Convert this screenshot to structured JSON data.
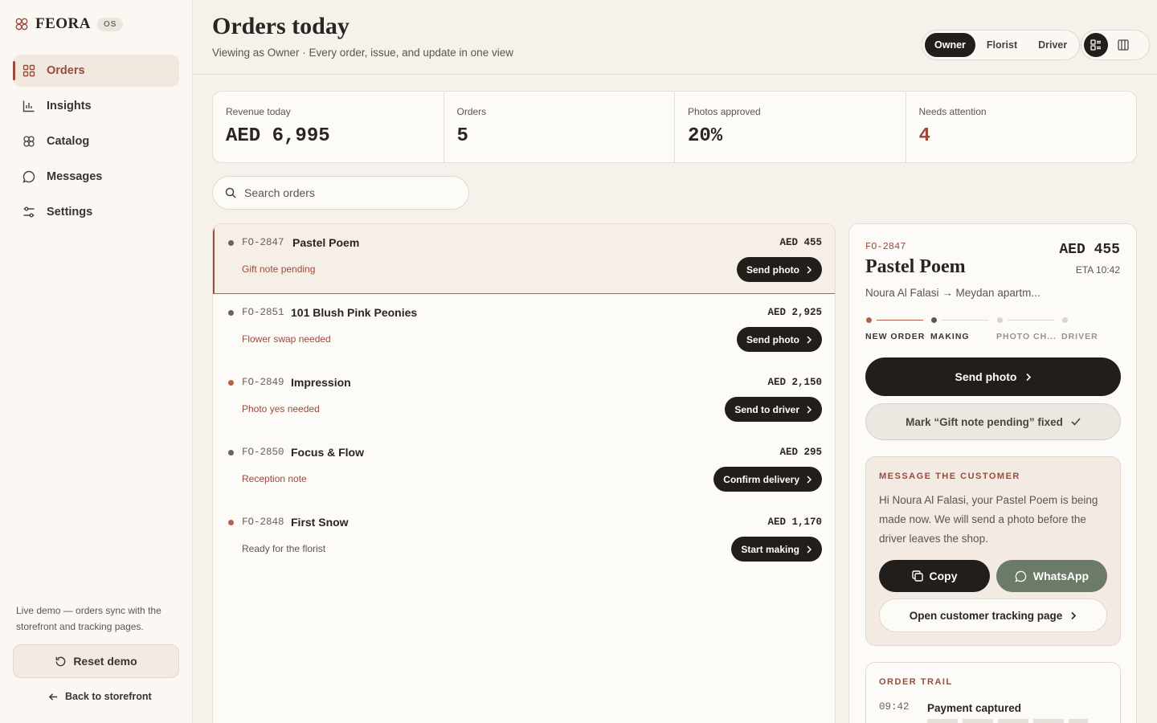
{
  "brand": {
    "name": "FEORA",
    "badge": "OS"
  },
  "sidebar": {
    "items": [
      {
        "label": "Orders",
        "icon": "grid-icon",
        "active": true
      },
      {
        "label": "Insights",
        "icon": "bar-chart-icon",
        "active": false
      },
      {
        "label": "Catalog",
        "icon": "flower-icon",
        "active": false
      },
      {
        "label": "Messages",
        "icon": "chat-bubble-icon",
        "active": false
      },
      {
        "label": "Settings",
        "icon": "sliders-icon",
        "active": false
      }
    ],
    "note": "Live demo — orders sync with the storefront and tracking pages.",
    "reset_label": "Reset demo",
    "back_label": "Back to storefront"
  },
  "header": {
    "title": "Orders today",
    "subtitle": "Viewing as Owner · Every order, issue, and update in one view",
    "roles": [
      "Owner",
      "Florist",
      "Driver"
    ],
    "active_role": "Owner",
    "views": [
      "list-view-icon",
      "board-view-icon"
    ],
    "active_view": "list-view-icon"
  },
  "stats": [
    {
      "label": "Revenue today",
      "value": "AED 6,995"
    },
    {
      "label": "Orders",
      "value": "5"
    },
    {
      "label": "Photos approved",
      "value": "20%"
    },
    {
      "label": "Needs attention",
      "value": "4"
    }
  ],
  "search": {
    "placeholder": "Search orders",
    "value": ""
  },
  "orders": [
    {
      "id": "FO-2847",
      "name": "Pastel Poem",
      "note": "Gift note pending",
      "price": "AED 455",
      "action": "Send photo",
      "selected": true
    },
    {
      "id": "FO-2851",
      "name": "101 Blush Pink Peonies",
      "note": "Flower swap needed",
      "price": "AED 2,925",
      "action": "Send photo"
    },
    {
      "id": "FO-2849",
      "name": "Impression",
      "note": "Photo yes needed",
      "price": "AED 2,150",
      "action": "Send to driver"
    },
    {
      "id": "FO-2850",
      "name": "Focus & Flow",
      "note": "Reception note",
      "price": "AED 295",
      "action": "Confirm delivery"
    },
    {
      "id": "FO-2848",
      "name": "First Snow",
      "note": "Ready for the florist",
      "price": "AED 1,170",
      "action": "Start making"
    }
  ],
  "detail": {
    "id": "FO-2847",
    "price": "AED 455",
    "eta": "ETA 10:42",
    "name": "Pastel Poem",
    "route": "Noura Al Falasi → Meydan apartm...",
    "steps": [
      "NEW ORDER",
      "MAKING",
      "PHOTO CH...",
      "DRIVER"
    ],
    "current_step": "MAKING",
    "primary_action": "Send photo",
    "secondary_action": "Mark “Gift note pending” fixed",
    "message": {
      "title": "MESSAGE THE CUSTOMER",
      "text": "Hi Noura Al Falasi, your Pastel Poem is being made now. We will send a photo before the driver leaves the shop.",
      "copy_label": "Copy",
      "whatsapp_label": "WhatsApp",
      "tracking_label": "Open customer tracking page"
    },
    "trail": {
      "title": "ORDER TRAIL",
      "entries": [
        {
          "time": "09:42",
          "event": "Payment captured"
        }
      ]
    }
  },
  "colors": {
    "accent": "#9a4b3c",
    "dark": "#221e1b",
    "whatsapp": "#6c7a68",
    "background": "#f6f1ea"
  }
}
